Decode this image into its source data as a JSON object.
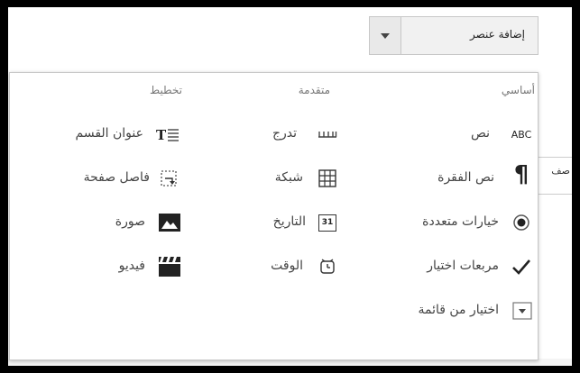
{
  "toolbar": {
    "add_item_label": "إضافة عنصر"
  },
  "background": {
    "partial_label": "صف"
  },
  "menu": {
    "columns": {
      "basic": "أساسي",
      "advanced": "متقدمة",
      "layout": "تخطيط"
    },
    "basic_items": [
      {
        "label": "نص",
        "icon": "abc-icon",
        "icon_text": "ABC"
      },
      {
        "label": "نص الفقرة",
        "icon": "pilcrow-icon",
        "icon_text": "¶"
      },
      {
        "label": "خيارات متعددة",
        "icon": "radio-icon"
      },
      {
        "label": "مربعات اختيار",
        "icon": "checkbox-icon",
        "icon_text": "✓"
      },
      {
        "label": "اختيار من قائمة",
        "icon": "dropdown-icon"
      }
    ],
    "advanced_items": [
      {
        "label": "تدرج",
        "icon": "scale-icon"
      },
      {
        "label": "شبكة",
        "icon": "grid-icon"
      },
      {
        "label": "التاريخ",
        "icon": "calendar-icon",
        "icon_text": "31"
      },
      {
        "label": "الوقت",
        "icon": "clock-icon"
      }
    ],
    "layout_items": [
      {
        "label": "عنوان القسم",
        "icon": "section-header-icon"
      },
      {
        "label": "فاصل صفحة",
        "icon": "page-break-icon"
      },
      {
        "label": "صورة",
        "icon": "image-icon"
      },
      {
        "label": "فيديو",
        "icon": "video-icon"
      }
    ]
  }
}
